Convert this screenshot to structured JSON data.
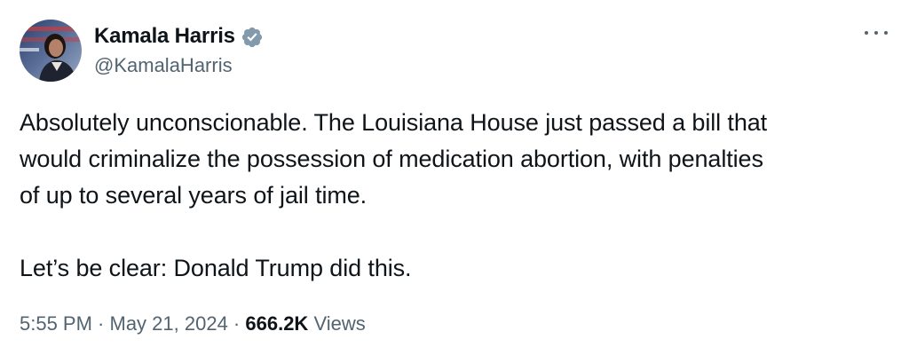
{
  "author": {
    "display_name": "Kamala Harris",
    "handle": "@KamalaHarris",
    "verified_icon": "verified-badge-icon",
    "verified_color": "#829aab"
  },
  "tweet": {
    "lines_para1": [
      "Absolutely unconscionable. The Louisiana House just passed a bill that",
      "would criminalize the possession of medication abortion, with penalties",
      "of up to several years of jail time."
    ],
    "para2": "Let’s be clear: Donald Trump did this."
  },
  "meta": {
    "time": "5:55 PM",
    "separator": " · ",
    "date": "May 21, 2024",
    "views_count": "666.2K",
    "views_label": "Views"
  },
  "more_icon": "ellipsis-icon",
  "colors": {
    "text_primary": "#0f1419",
    "text_secondary": "#536471",
    "background": "#ffffff"
  }
}
